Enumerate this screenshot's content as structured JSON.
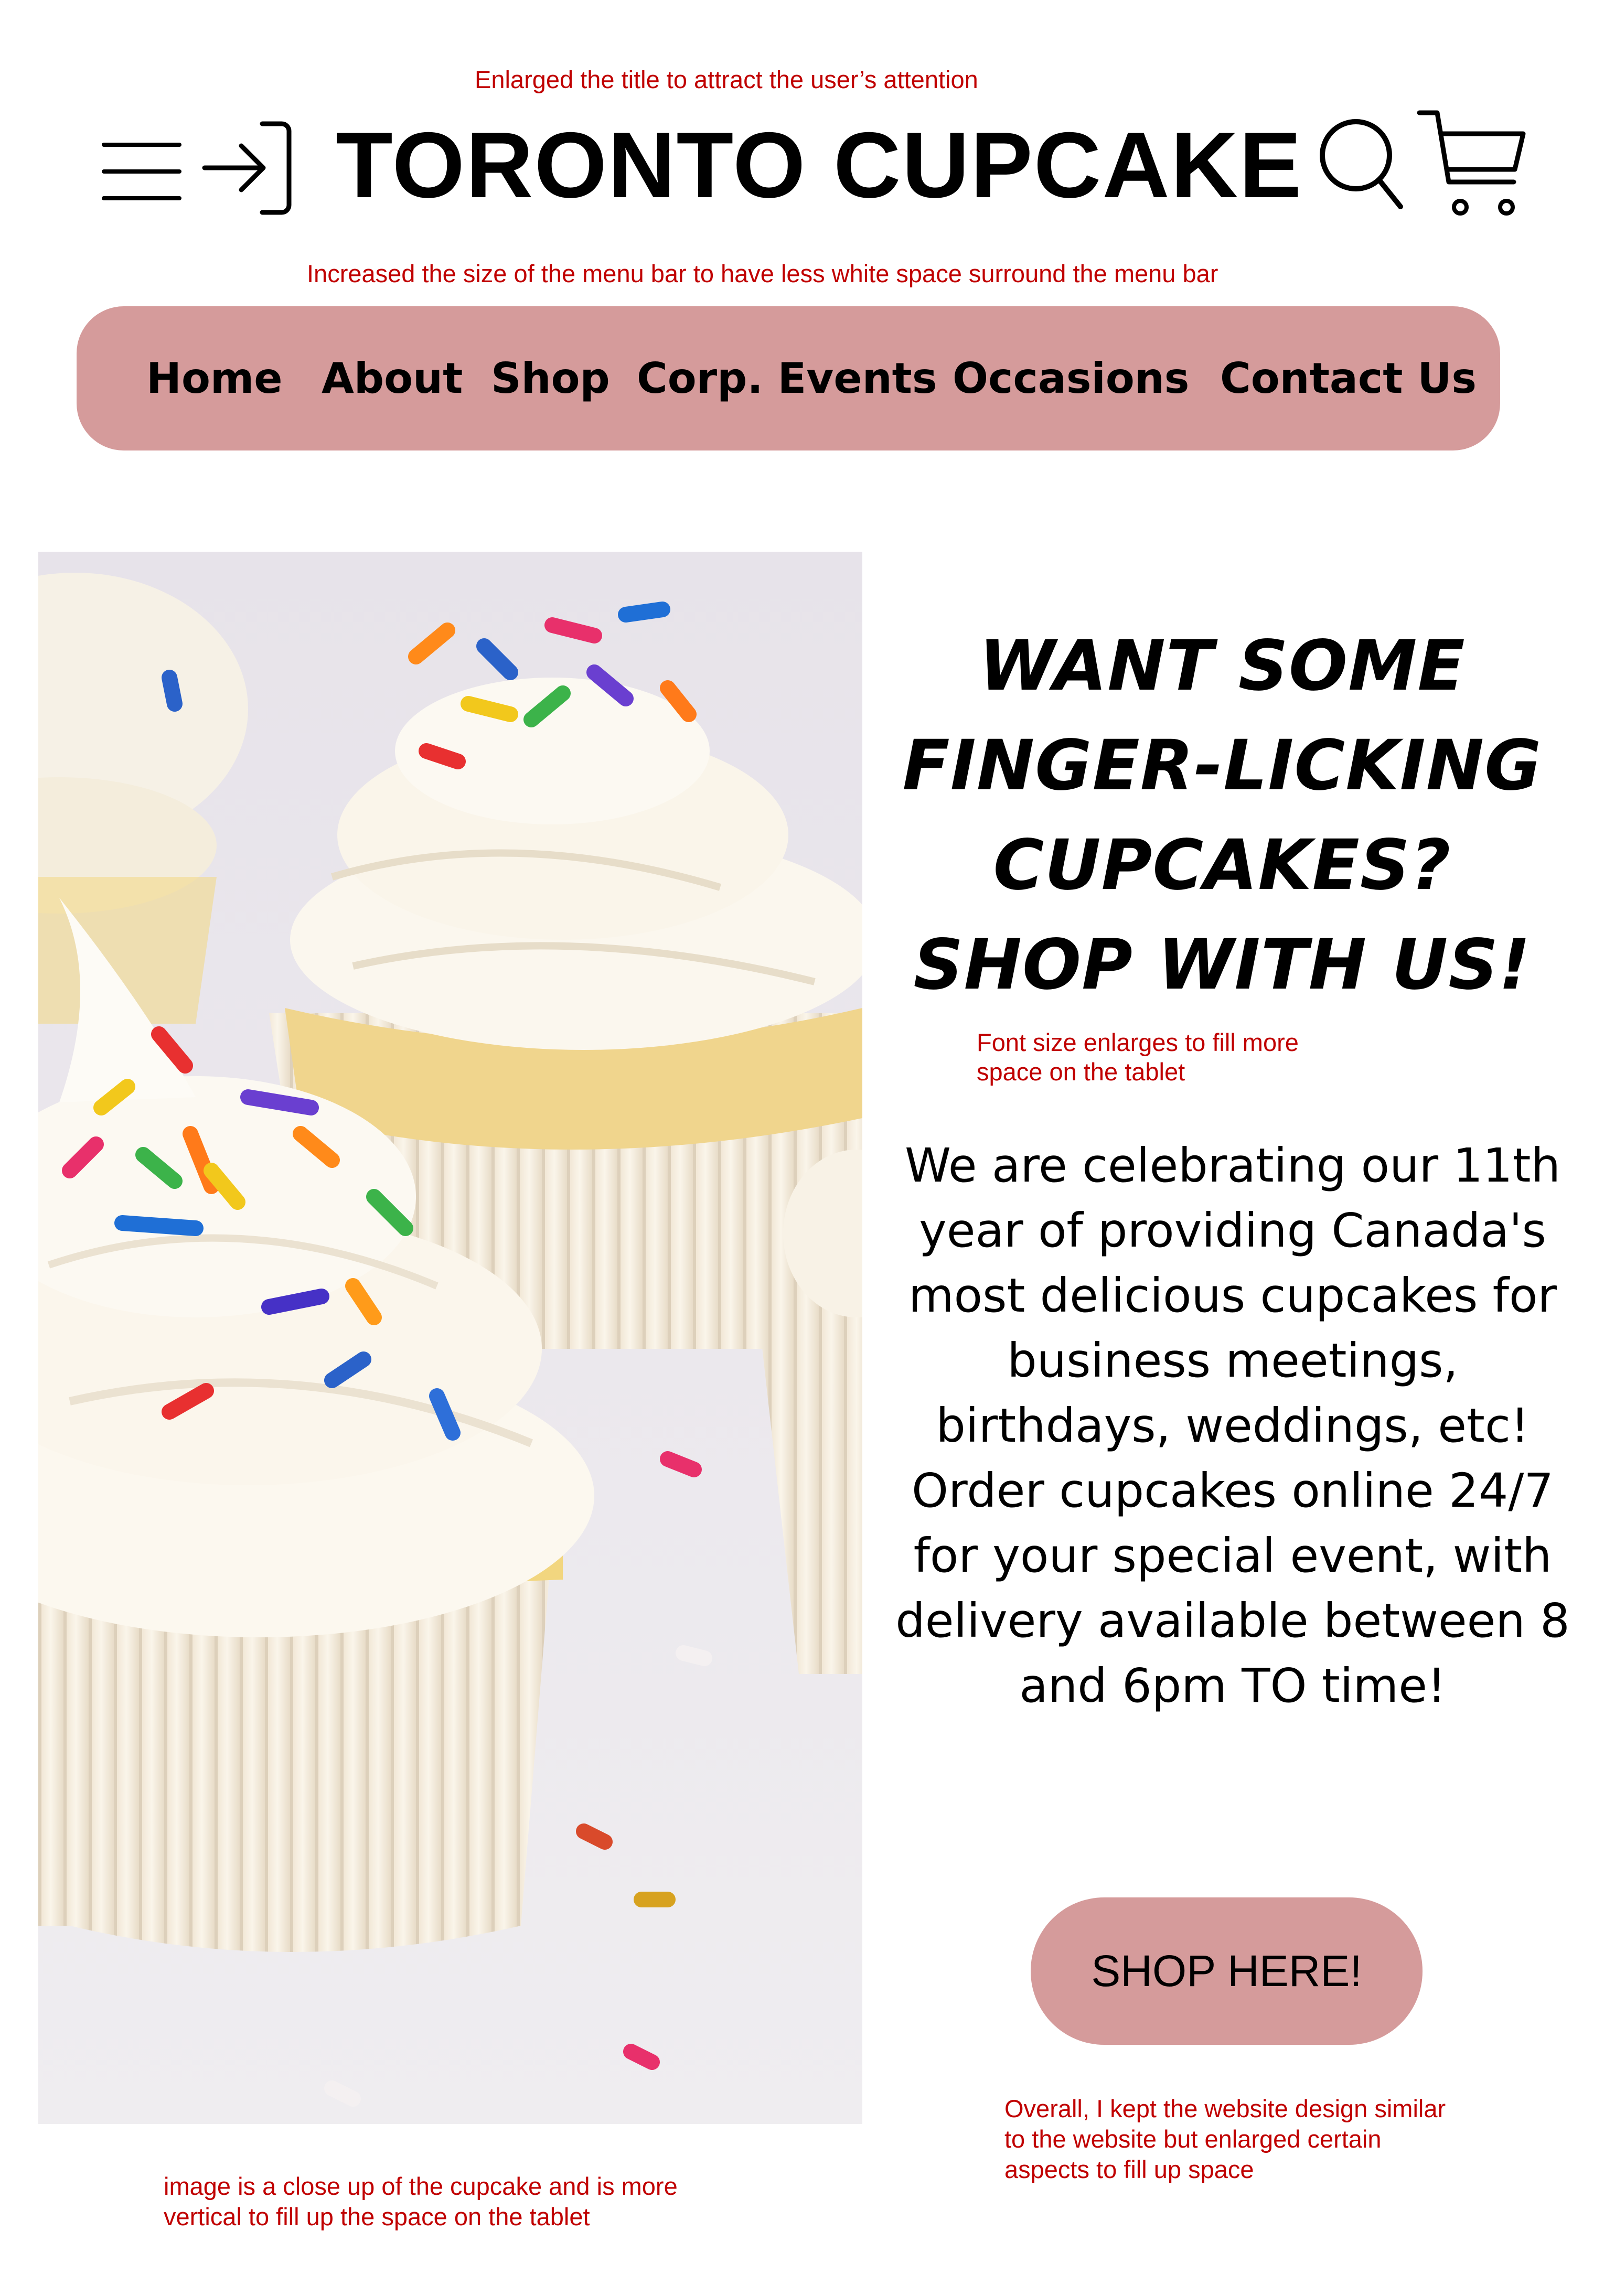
{
  "annotations": {
    "title_note": "Enlarged the title to attract the user’s attention",
    "menu_note": "Increased the size of the menu bar to have less white space surround the menu bar",
    "font_note": [
      "Font size enlarges to fill more",
      "space on the tablet"
    ],
    "overall_note": [
      "Overall, I kept the website design similar",
      "to the website but enlarged certain",
      "aspects to fill up space"
    ],
    "image_note": [
      "image is a close up of the cupcake and is more",
      "vertical to fill up the space on the tablet"
    ]
  },
  "header": {
    "title": "TORONTO CUPCAKE",
    "icons": [
      "menu-icon",
      "login-icon",
      "search-icon",
      "cart-icon"
    ]
  },
  "nav": {
    "items": [
      "Home",
      "About",
      "Shop",
      "Corp. Events",
      "Occasions",
      "Contact Us"
    ]
  },
  "hero": {
    "image_icon": "cupcakes-photo",
    "headline": [
      "WANT SOME",
      "FINGER-LICKING",
      "CUPCAKES?",
      "SHOP WITH US!"
    ],
    "body": [
      "We are celebrating our 11th",
      "year of providing Canada's",
      "most delicious cupcakes for",
      "business meetings,",
      "birthdays, weddings, etc!",
      "Order cupcakes online 24/7",
      "for your special event, with",
      "delivery available between 8",
      "and 6pm TO time!"
    ],
    "cta_label": "SHOP HERE!"
  },
  "colors": {
    "accent_pink": "#d59b9b",
    "note_red": "#c00000",
    "text": "#000000",
    "background": "#ffffff"
  }
}
